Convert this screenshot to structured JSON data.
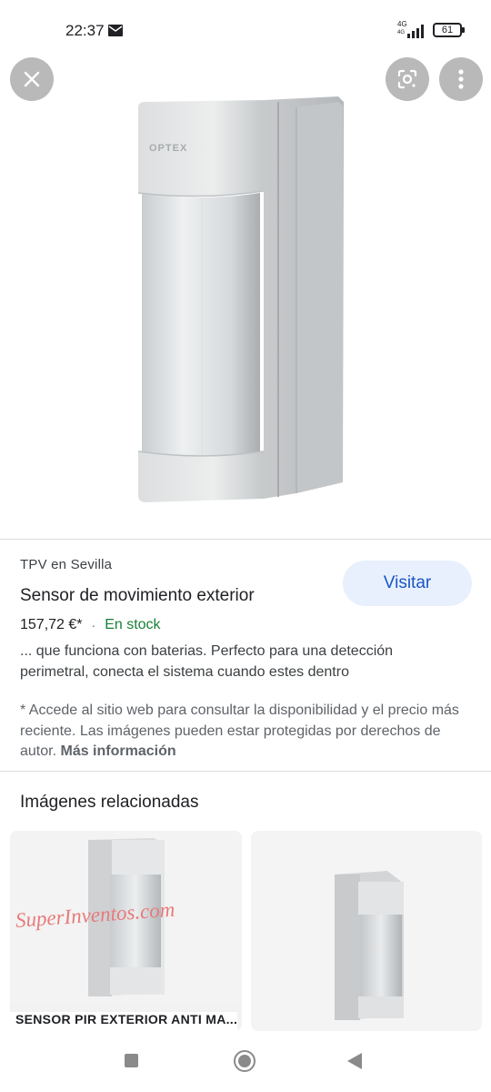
{
  "status_bar": {
    "time": "22:37",
    "network": "4G",
    "network_sub": "4G",
    "battery": "61",
    "icons": [
      "mail-icon",
      "signal-icon",
      "battery-icon"
    ]
  },
  "top_actions": {
    "icons": [
      "close-icon",
      "lens-icon",
      "more-vert-icon"
    ]
  },
  "hero": {
    "brand_mark": "OPTEX"
  },
  "product": {
    "source": "TPV en Sevilla",
    "title": "Sensor de movimiento exterior",
    "price": "157,72 €*",
    "separator": "·",
    "stock": "En stock",
    "visit_label": "Visitar",
    "description": "... que funciona con baterias. Perfecto para una detección perimetral, conecta el sistema cuando estes dentro",
    "notice": "* Accede al sitio web para consultar la disponibilidad y el precio más reciente. Las imágenes pueden estar protegidas por derechos de autor.",
    "more_info": "Más información"
  },
  "related": {
    "heading": "Imágenes relacionadas",
    "items": [
      {
        "caption": "SENSOR PIR EXTERIOR ANTI MA...",
        "watermark": "SuperInventos.com"
      },
      {
        "caption": ""
      }
    ]
  },
  "nav_bar": {
    "icons": [
      "recents-icon",
      "home-icon",
      "back-icon"
    ]
  },
  "colors": {
    "accent": "#1a56c4",
    "visit_bg": "#e8f0fe",
    "stock": "#188038",
    "fab_bg": "#b9b9b9"
  }
}
